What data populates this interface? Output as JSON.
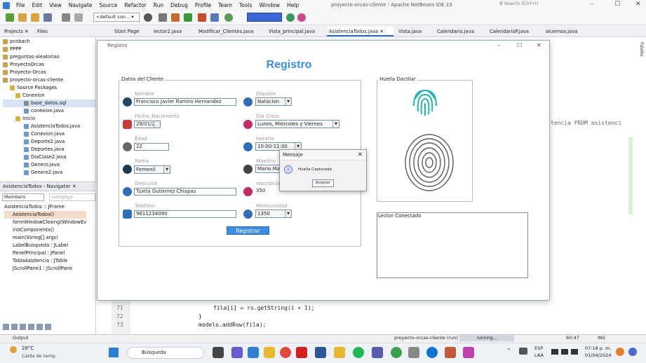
{
  "menu": {
    "items": [
      "File",
      "Edit",
      "View",
      "Navigate",
      "Source",
      "Refactor",
      "Run",
      "Debug",
      "Profile",
      "Team",
      "Tools",
      "Window",
      "Help"
    ]
  },
  "window": {
    "title": "proyecto-orcas-cliente - Apache NetBeans IDE 13",
    "search_placeholder": "Search (Ctrl+I)",
    "minimize": "–",
    "maximize": "☐",
    "close": "✕"
  },
  "toolbar": {
    "config_value": "<default con..."
  },
  "leftpanel": {
    "tabs": [
      "Projects",
      "Files"
    ],
    "tree": [
      "pcobach",
      "PPPP",
      "preguntas-aleatorias",
      "ProyectoOrcas",
      "Proyecto-Orcas",
      "proyecto-orcas-cliente",
      "Source Packages",
      "Conexion",
      "base_datos.sql",
      "conexion.java",
      "Inicio",
      "AsistenciaTodos.java",
      "Conexion.java",
      "Deporte2.java",
      "Deportes.java",
      "DiaClase2.java",
      "Genero.java",
      "Genero2.java"
    ]
  },
  "navigator": {
    "title": "AsistenciaTodos - Navigator",
    "filter": "Members",
    "empty": "<empty>",
    "items": [
      "AsistenciaTodos :: JFrame",
      "AsistenciaTodos()",
      "formWindowClosing(WindowEv",
      "initComponents()",
      "main(String[] args)",
      "LabelBusqueda : JLabel",
      "PanelPrincipal : JPanel",
      "TablaAsistencia : JTable",
      "JScrollPane1 : JScrollPane"
    ]
  },
  "tabs": [
    "Start Page",
    "lector2.java",
    "Modificar_Clientes.java",
    "Vista_principal.java",
    "AsistenciaTodos.java",
    "Vista.java",
    "Calendario.java",
    "CalendarioP.java",
    "alumnos.java"
  ],
  "editor": {
    "snippet": "tencia FROM asistenci",
    "line_numbers": [
      "71",
      "72",
      "73"
    ],
    "lines": [
      "fila[i] = rs.getString(i + 1);",
      "}",
      "modelo.addRow(fila);"
    ]
  },
  "dialog": {
    "title": "Registro",
    "heading": "Registro",
    "group_cliente": "Datos del Cliente",
    "group_huella": "Huella Dactilar",
    "fields": {
      "nombre": {
        "label": "Nombre",
        "value": "Francisco Javier Ramiro Hernandez"
      },
      "fecha": {
        "label": "Fecha_Nacimiento",
        "value": "28/01/2"
      },
      "edad": {
        "label": "Edad",
        "value": "22"
      },
      "rama": {
        "label": "Rama",
        "value": "Femenil"
      },
      "direccion": {
        "label": "Direccion",
        "value": "Tuxtla Gutierrez Chiapas"
      },
      "telefono": {
        "label": "Telefono",
        "value": "9611234090"
      },
      "deporte": {
        "label": "Deporte",
        "value": "Natacion"
      },
      "diaclase": {
        "label": "Dia Clase",
        "value": "Lunes, Miercoles y Viernes"
      },
      "horario": {
        "label": "Horario",
        "value": "10:00-11:00"
      },
      "maestro": {
        "label": "Maestro",
        "value": "Mario Ma"
      },
      "inscripcion": {
        "label": "Inscripcion",
        "value": "350"
      },
      "mensualidad": {
        "label": "Mensualidad",
        "value": "1350"
      }
    },
    "register_button": "Registrar",
    "lector_status": "Lector Conectado"
  },
  "message": {
    "title": "Mensaje",
    "text": "Huella Capturada",
    "ok": "Aceptar",
    "close": "✕"
  },
  "statusbar": {
    "output": "Output",
    "project": "proyecto-orcas-cliente (run)",
    "running": "running...",
    "position": "60:47",
    "mode": "INS"
  },
  "taskbar": {
    "weather_temp": "28°C",
    "weather_text": "Caída de temp.",
    "search": "Búsqueda",
    "lang": "ESP",
    "lang2": "LAA",
    "time": "07:18 p. m.",
    "date": "01/04/2024"
  },
  "colors": {
    "accent": "#3a8ee6",
    "teal": "#1fb5b0"
  }
}
